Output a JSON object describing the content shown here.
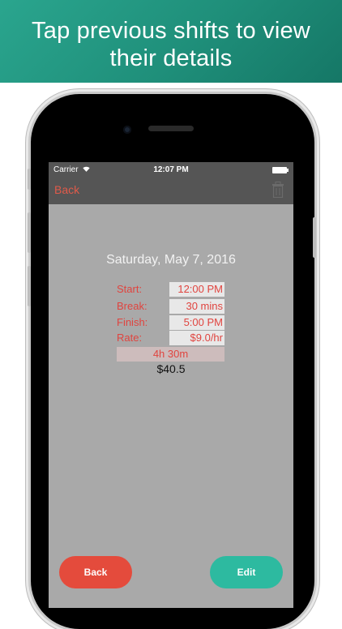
{
  "banner": {
    "line1": "Tap previous shifts to view",
    "line2": "their details"
  },
  "status_bar": {
    "carrier": "Carrier",
    "time": "12:07 PM"
  },
  "nav": {
    "back_label": "Back",
    "trash_icon": "trash-icon"
  },
  "shift": {
    "date": "Saturday, May 7, 2016",
    "fields": [
      {
        "label": "Start:",
        "value": "12:00 PM"
      },
      {
        "label": "Break:",
        "value": "30 mins"
      },
      {
        "label": "Finish:",
        "value": "5:00 PM"
      },
      {
        "label": "Rate:",
        "value": "$9.0/hr"
      }
    ],
    "duration": "4h 30m",
    "total": "$40.5"
  },
  "buttons": {
    "back_label": "Back",
    "edit_label": "Edit"
  },
  "colors": {
    "banner": "#1f8f7a",
    "accent_red": "#e0443f",
    "edit_green": "#2dbaa0"
  }
}
